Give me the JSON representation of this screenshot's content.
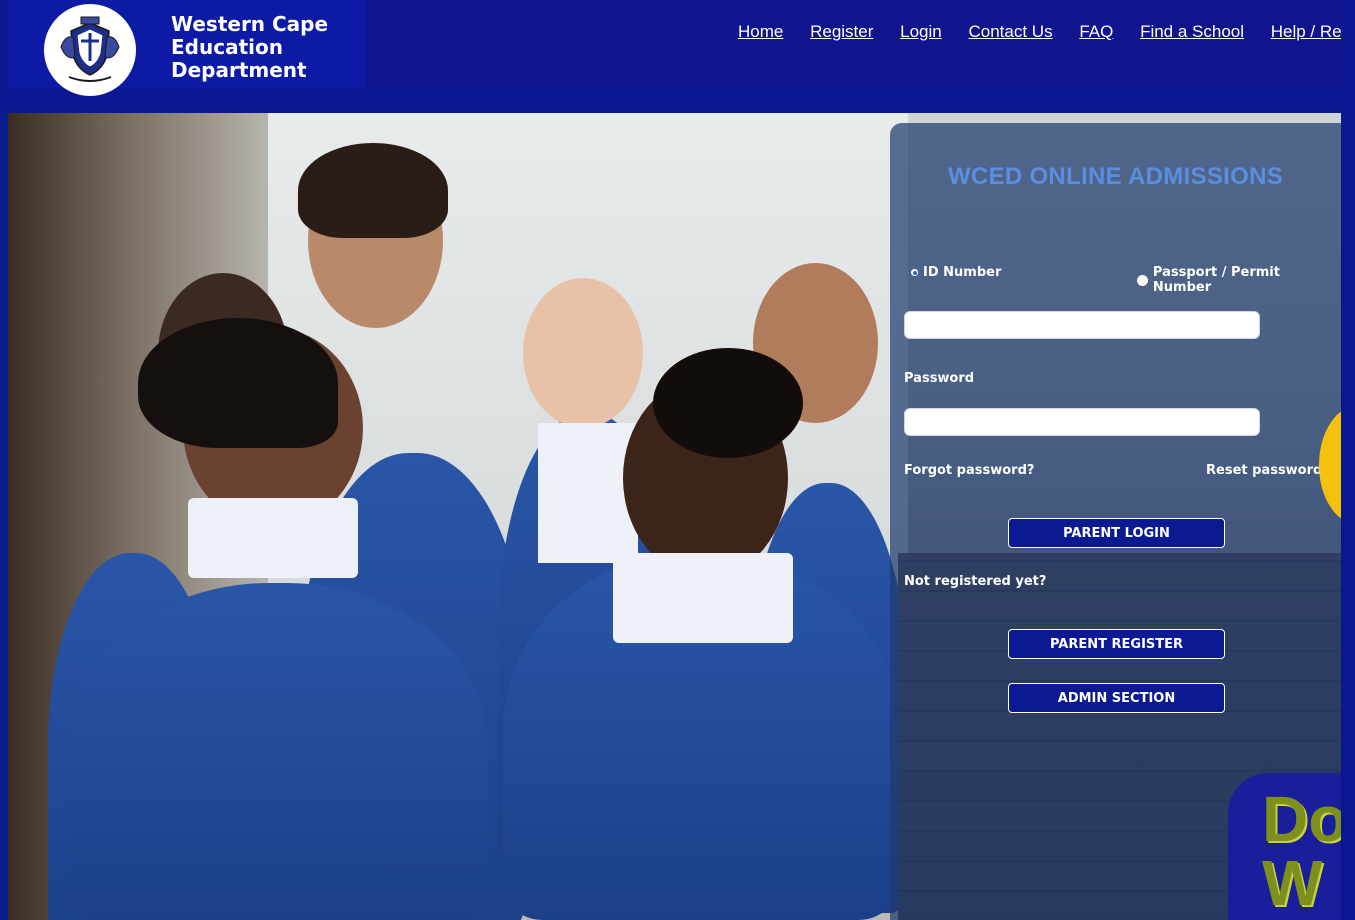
{
  "header": {
    "logo_icon": "coat-of-arms-icon",
    "brand_line1": "Western Cape",
    "brand_line2": "Education",
    "brand_line3": "Department"
  },
  "nav": {
    "items": [
      {
        "label": "Home"
      },
      {
        "label": "Register"
      },
      {
        "label": "Login"
      },
      {
        "label": "Contact Us"
      },
      {
        "label": "FAQ"
      },
      {
        "label": "Find a School"
      },
      {
        "label": "Help / Resc"
      }
    ]
  },
  "login": {
    "title": "WCED ONLINE ADMISSIONS",
    "radio_id_label": "ID Number",
    "radio_passport_label": "Passport / Permit Number",
    "selected_option": "ID Number",
    "id_value": "",
    "password_label": "Password",
    "password_value": "",
    "forgot_label": "Forgot password?",
    "reset_label": "Reset password?",
    "parent_login_label": "PARENT LOGIN",
    "not_registered_label": "Not registered yet?",
    "parent_register_label": "PARENT REGISTER",
    "admin_label": "ADMIN SECTION"
  },
  "promo": {
    "text_line1": "Do",
    "text_line2": "W"
  },
  "colors": {
    "brand_blue": "#0a1790",
    "title_blue": "#5b8de0",
    "accent_yellow": "#f4c10f"
  }
}
